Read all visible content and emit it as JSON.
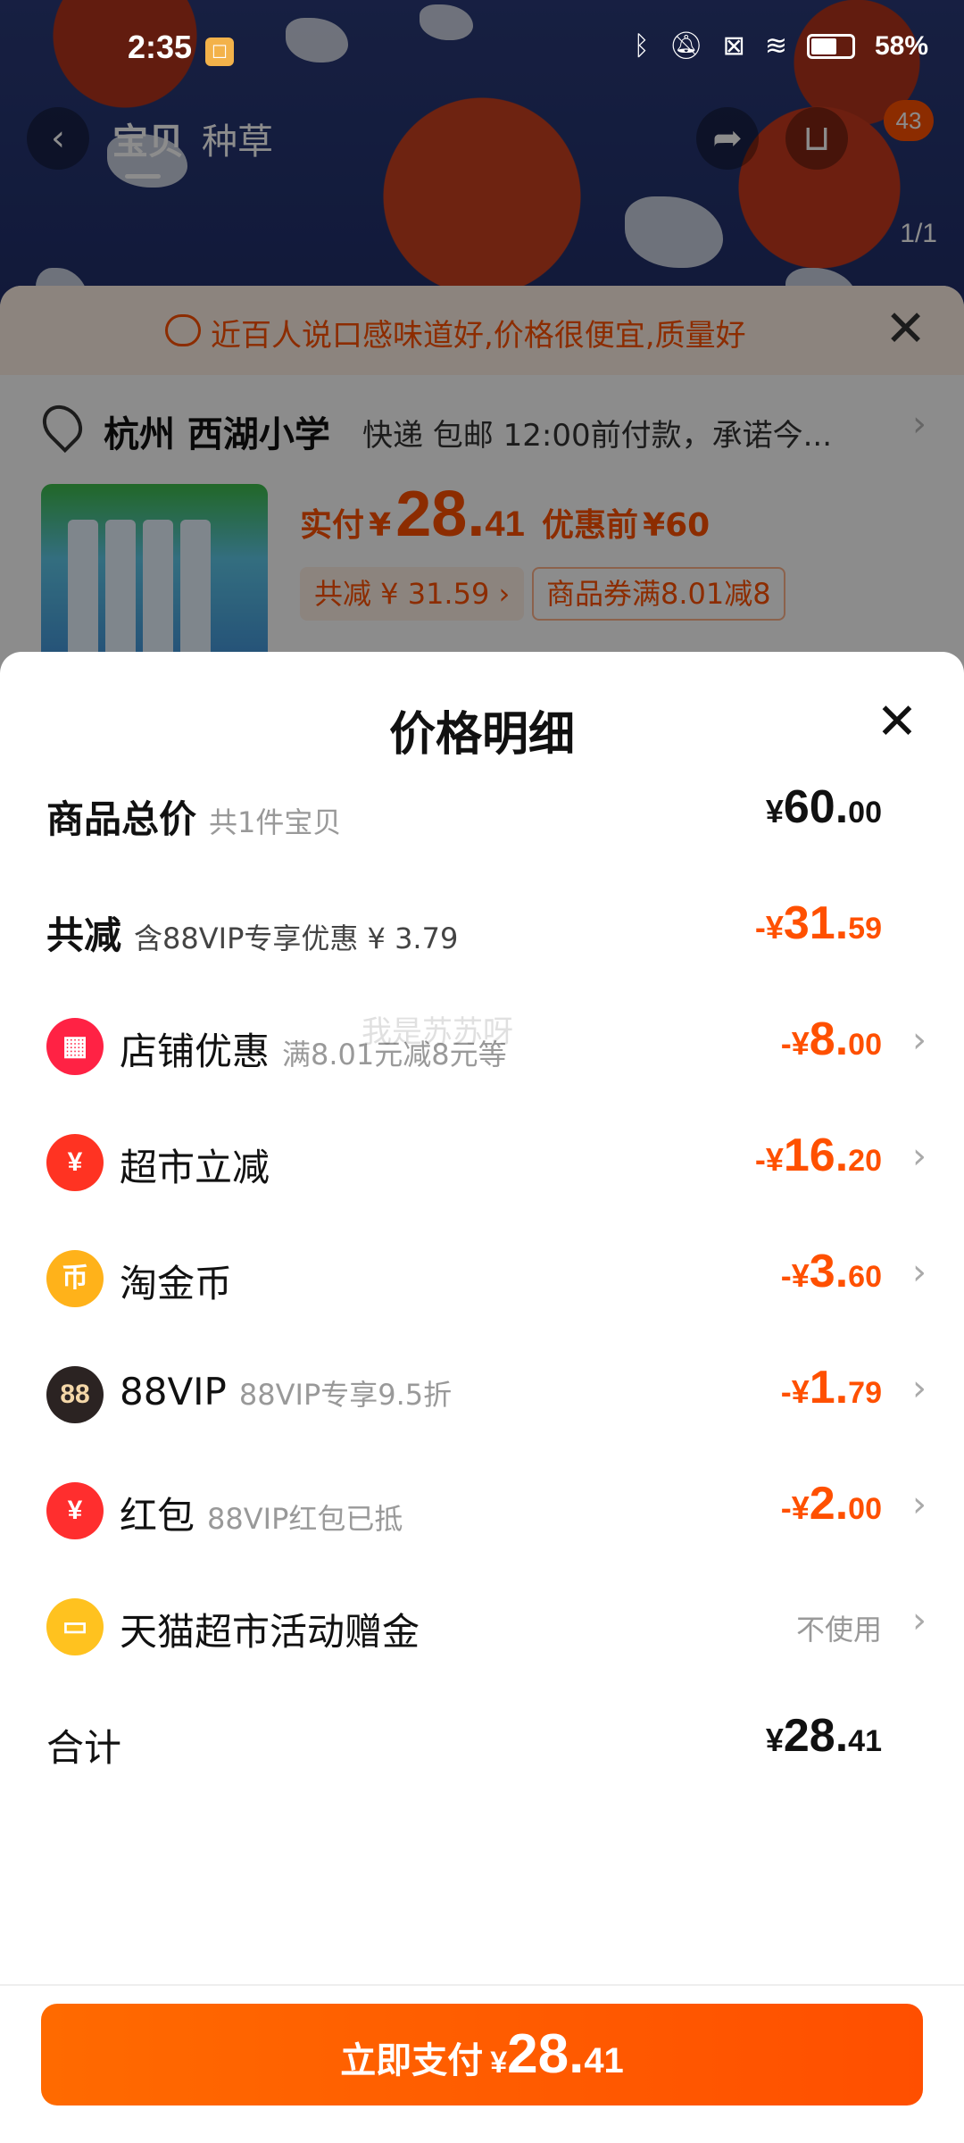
{
  "status_bar": {
    "time": "2:35",
    "battery": "58%"
  },
  "nav": {
    "tabs": [
      "宝贝",
      "种草"
    ],
    "cart_count": "43",
    "image_counter": "1/1"
  },
  "notice": {
    "text": "近百人说口感味道好,价格很便宜,质量好"
  },
  "address": {
    "city": "杭州 西湖小学",
    "detail": "快递 包邮 12:00前付款，承诺今..."
  },
  "product_price": {
    "label": "实付",
    "currency": "¥",
    "integer": "28.",
    "decimal": "41",
    "before_label": "优惠前",
    "before_value": "¥60",
    "saved_tag": "共减 ¥ 31.59 ›",
    "coupon_tag": "商品券满8.01减8"
  },
  "sheet": {
    "title": "价格明细",
    "rows": [
      {
        "label": "商品总价",
        "sub": "共1件宝贝",
        "currency": "¥",
        "integer": "60.",
        "decimal": "00",
        "type": "plain"
      },
      {
        "label": "共减",
        "sub": "含88VIP专享优惠 ¥ 3.79",
        "currency": "-¥",
        "integer": "31.",
        "decimal": "59",
        "type": "red"
      },
      {
        "label": "店铺优惠",
        "sub": "满8.01元减8元等",
        "currency": "-¥",
        "integer": "8.",
        "decimal": "00",
        "icon": "shop-icon",
        "type": "red"
      },
      {
        "label": "超市立减",
        "sub": "",
        "currency": "-¥",
        "integer": "16.",
        "decimal": "20",
        "icon": "yuan-coin-icon",
        "type": "red"
      },
      {
        "label": "淘金币",
        "sub": "",
        "currency": "-¥",
        "integer": "3.",
        "decimal": "60",
        "icon": "gold-coin-icon",
        "type": "red"
      },
      {
        "label": "88VIP",
        "sub": "88VIP专享9.5折",
        "currency": "-¥",
        "integer": "1.",
        "decimal": "79",
        "icon": "vip88-icon",
        "type": "red"
      },
      {
        "label": "红包",
        "sub": "88VIP红包已抵",
        "currency": "-¥",
        "integer": "2.",
        "decimal": "00",
        "icon": "red-packet-icon",
        "type": "red"
      },
      {
        "label": "天猫超市活动赠金",
        "sub": "",
        "right_text": "不使用",
        "icon": "gift-card-icon",
        "type": "muted"
      },
      {
        "label": "合计",
        "sub": "",
        "currency": "¥",
        "integer": "28.",
        "decimal": "41",
        "type": "plain"
      }
    ],
    "icon_glyphs": {
      "vip": "88",
      "market": "¥",
      "coin": "币",
      "packet": "¥"
    }
  },
  "pay_button": {
    "label": "立即支付",
    "currency": "¥",
    "integer": "28.",
    "decimal": "41"
  },
  "watermark": "我是苏苏呀",
  "colors": {
    "accent": "#ff5000",
    "sheet_bg": "#ffffff"
  }
}
